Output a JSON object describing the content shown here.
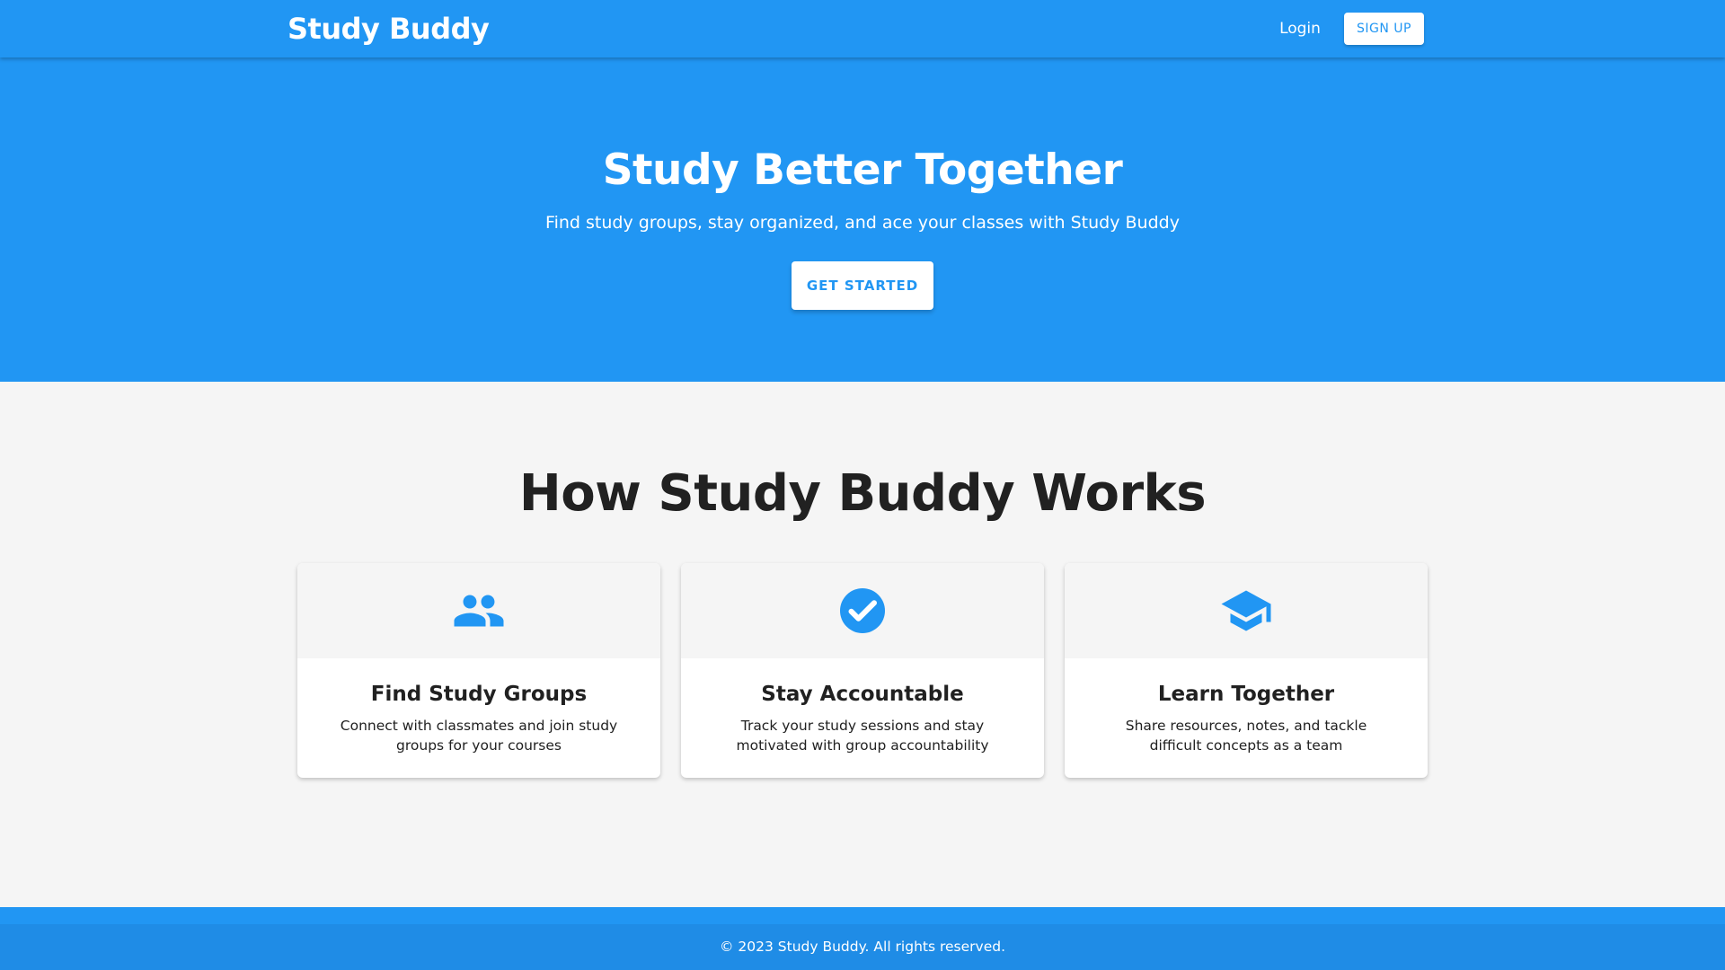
{
  "colors": {
    "primary": "#2196f3",
    "background": "#f5f5f5",
    "text": "#212121",
    "white": "#ffffff"
  },
  "navbar": {
    "brand": "Study Buddy",
    "login_label": "Login",
    "signup_label": "SIGN UP"
  },
  "hero": {
    "title": "Study Better Together",
    "subtitle": "Find study groups, stay organized, and ace your classes with Study Buddy",
    "cta_label": "GET STARTED"
  },
  "features": {
    "title": "How Study Buddy Works",
    "cards": [
      {
        "icon": "group-icon",
        "title": "Find Study Groups",
        "text": "Connect with classmates and join study groups for your courses"
      },
      {
        "icon": "check-circle-icon",
        "title": "Stay Accountable",
        "text": "Track your study sessions and stay motivated with group accountability"
      },
      {
        "icon": "graduation-cap-icon",
        "title": "Learn Together",
        "text": "Share resources, notes, and tackle difficult concepts as a team"
      }
    ]
  },
  "footer": {
    "copyright": "© 2023 Study Buddy. All rights reserved."
  }
}
